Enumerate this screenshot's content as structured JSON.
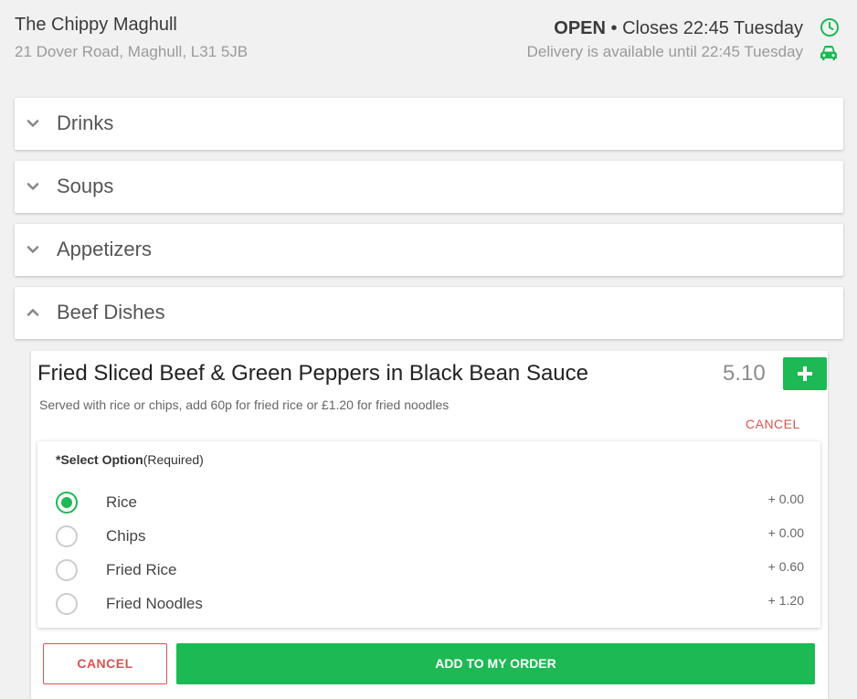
{
  "shop": {
    "name": "The Chippy Maghull",
    "address": "21 Dover Road, Maghull, L31 5JB",
    "status": "OPEN",
    "closes": "• Closes 22:45 Tuesday",
    "delivery": "Delivery is available until 22:45 Tuesday"
  },
  "categories": [
    {
      "label": "Drinks"
    },
    {
      "label": "Soups"
    },
    {
      "label": "Appetizers"
    },
    {
      "label": "Beef Dishes"
    }
  ],
  "item": {
    "title": "Fried Sliced Beef & Green Peppers in Black Bean Sauce",
    "price": "5.10",
    "description": "Served with rice or chips, add 60p for fried rice or £1.20 for fried noodles",
    "cancel_link": "CANCEL",
    "option_heading": "*Select Option",
    "option_required": "(Required)",
    "options": [
      {
        "label": "Rice",
        "price": "+ 0.00",
        "selected": true
      },
      {
        "label": "Chips",
        "price": "+ 0.00",
        "selected": false
      },
      {
        "label": "Fried Rice",
        "price": "+ 0.60",
        "selected": false
      },
      {
        "label": "Fried Noodles",
        "price": "+ 1.20",
        "selected": false
      }
    ],
    "cancel_button": "CANCEL",
    "add_button": "ADD TO MY ORDER"
  },
  "colors": {
    "accent_green": "#1db954",
    "cancel_red": "#d9534f",
    "background": "#f1f1f1"
  },
  "icons": [
    "clock-icon",
    "car-icon",
    "chevron-down-icon",
    "chevron-up-icon",
    "plus-icon"
  ]
}
